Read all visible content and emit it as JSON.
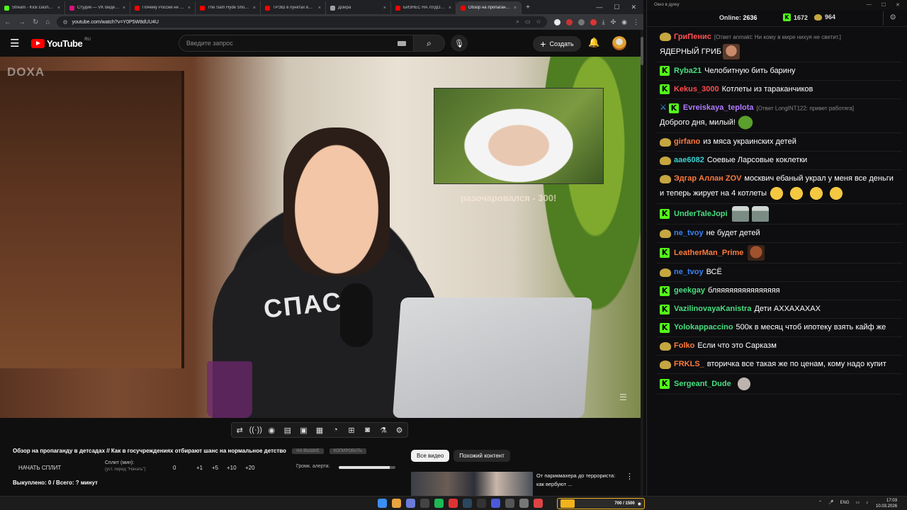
{
  "browser": {
    "tabs": [
      {
        "title": "Stream - Kick Dashboard",
        "color": "#53fc18",
        "active": false
      },
      {
        "title": "Студия — VK Видео Live",
        "color": "#d8127d",
        "active": false
      },
      {
        "title": "Почему России не даёт...",
        "color": "#ff0000",
        "active": false
      },
      {
        "title": "The Sam Hyde Show: D...",
        "color": "#ff0000",
        "active": false
      },
      {
        "title": "ТРЭШ в пунктах выда...",
        "color": "#ff0000",
        "active": false
      },
      {
        "title": "Дізйра",
        "color": "#9aa0a6",
        "active": false
      },
      {
        "title": "БИЗНЕС НА ЛУДОМА...",
        "color": "#ff0000",
        "active": false
      },
      {
        "title": "Обзор на пропаганду...",
        "color": "#ff0000",
        "active": true
      }
    ],
    "new_tab": "+",
    "url": "youtube.com/watch?v=Y0P5W8dUU4U",
    "window_buttons": {
      "minimize": "—",
      "maximize": "☐",
      "close": "✕"
    }
  },
  "youtube": {
    "logo_text": "YouTube",
    "logo_region": "RU",
    "search_placeholder": "Введите запрос",
    "create_label": "Создать",
    "video_watermark": "DOXA",
    "overlay_caption": "разочаровался - 300!",
    "sweater_text": "СПАС",
    "video_title": "Обзор на пропаганду в детсадах // Как в госучреждениях отбирают шанс на нормальное детство",
    "tag_in_queue": "НА ВЫШКЕ",
    "tag_copy": "КОПИРОВАТЬ",
    "start_split": "НАЧАТЬ СПЛИТ",
    "split_label": "Сплит (мин):",
    "split_hint": "(уст. перед \"Начать\")",
    "split_value": "0",
    "split_steps": [
      "+1",
      "+5",
      "+10",
      "+20"
    ],
    "alert_volume_label": "Громк. алерта:",
    "alert_volume_level": 0.9,
    "paid_text": "Выкуплено: 0 / Всего: ? минут",
    "chips": [
      "Все видео",
      "Похожий контент"
    ],
    "rec_title": "От парикмахера до террориста: как вербуют ..."
  },
  "chat": {
    "window_title": "Окно в духку",
    "online_label": "Online:",
    "online_count": "2636",
    "kick_count": "1672",
    "twitch_count": "964",
    "messages": [
      {
        "platform": "twitch",
        "user": "ГриПенис",
        "color": "#ff5252",
        "reply": "[Ответ anmakt: Ни кому в мире нихуя не светит.]",
        "text": "ЯДЕРНЫЙ ГРИБ",
        "emotes": [
          "face"
        ]
      },
      {
        "platform": "kick",
        "user": "Ryba21",
        "color": "#4ade80",
        "reply": "",
        "text": "Челобитную бить барину",
        "emotes": []
      },
      {
        "platform": "kick",
        "user": "Kekus_3000",
        "color": "#ff4d4d",
        "reply": "",
        "text": "Котлеты из тараканчиков",
        "emotes": []
      },
      {
        "platform": "kick",
        "user": "Evreiskaya_teplota",
        "color": "#b07cff",
        "reply": "[Ответ LongINT122: привет работяга]",
        "text": "Доброго дня, милый!",
        "emotes": [
          "pepe"
        ],
        "sword": true
      },
      {
        "platform": "twitch",
        "user": "girfano",
        "color": "#ff7a3c",
        "reply": "",
        "text": "из мяса украинских детей",
        "emotes": []
      },
      {
        "platform": "twitch",
        "user": "aae6082",
        "color": "#3bd0d0",
        "reply": "",
        "text": "Соевые Ларсовые коклетки",
        "emotes": []
      },
      {
        "platform": "twitch",
        "user": "Эдгар Аллан ZOV",
        "color": "#ff7a3c",
        "reply": "",
        "text": "москвич ебаный украл у меня все деньги и теперь жирует на 4 котлеты",
        "emotes": [
          "hug",
          "hug",
          "hug",
          "hug"
        ]
      },
      {
        "platform": "kick",
        "user": "UnderTaleJopi",
        "color": "#4ade80",
        "reply": "",
        "text": "",
        "emotes": [
          "bin",
          "bin"
        ]
      },
      {
        "platform": "twitch",
        "user": "ne_tvoy",
        "color": "#3b82f6",
        "reply": "",
        "text": "не будет детей",
        "emotes": []
      },
      {
        "platform": "kick",
        "user": "LeatherMan_Prime",
        "color": "#ff7a3c",
        "reply": "",
        "text": "",
        "emotes": [
          "cry"
        ]
      },
      {
        "platform": "twitch",
        "user": "ne_tvoy",
        "color": "#3b82f6",
        "reply": "",
        "text": "ВСЁ",
        "emotes": []
      },
      {
        "platform": "kick",
        "user": "geekgay",
        "color": "#4ade80",
        "reply": "",
        "text": "бляяяяяяяяяяяяяяя",
        "emotes": []
      },
      {
        "platform": "kick",
        "user": "VazilinovayaKanistra",
        "color": "#4ade80",
        "reply": "",
        "text": "Дети АХХАХАХАХ",
        "emotes": []
      },
      {
        "platform": "kick",
        "user": "Yolokappaccino",
        "color": "#4ade80",
        "reply": "",
        "text": "500к в месяц чтоб ипотеку взять кайф же",
        "emotes": []
      },
      {
        "platform": "twitch",
        "user": "Folko",
        "color": "#ff7a3c",
        "reply": "",
        "text": "Если что это Сарказм",
        "emotes": []
      },
      {
        "platform": "twitch",
        "user": "FRKLS_",
        "color": "#ff7a3c",
        "reply": "",
        "text": "вторичка все такая же по ценам, кому надо купит",
        "emotes": []
      },
      {
        "platform": "kick",
        "user": "Sergeant_Dude",
        "color": "#4ade80",
        "reply": "",
        "text": "",
        "emotes": [
          "rat"
        ]
      }
    ]
  },
  "taskbar": {
    "kick_widget_level": "700 / 1500",
    "lang": "ENG",
    "time": "17:03",
    "date": "10.03.2026"
  }
}
